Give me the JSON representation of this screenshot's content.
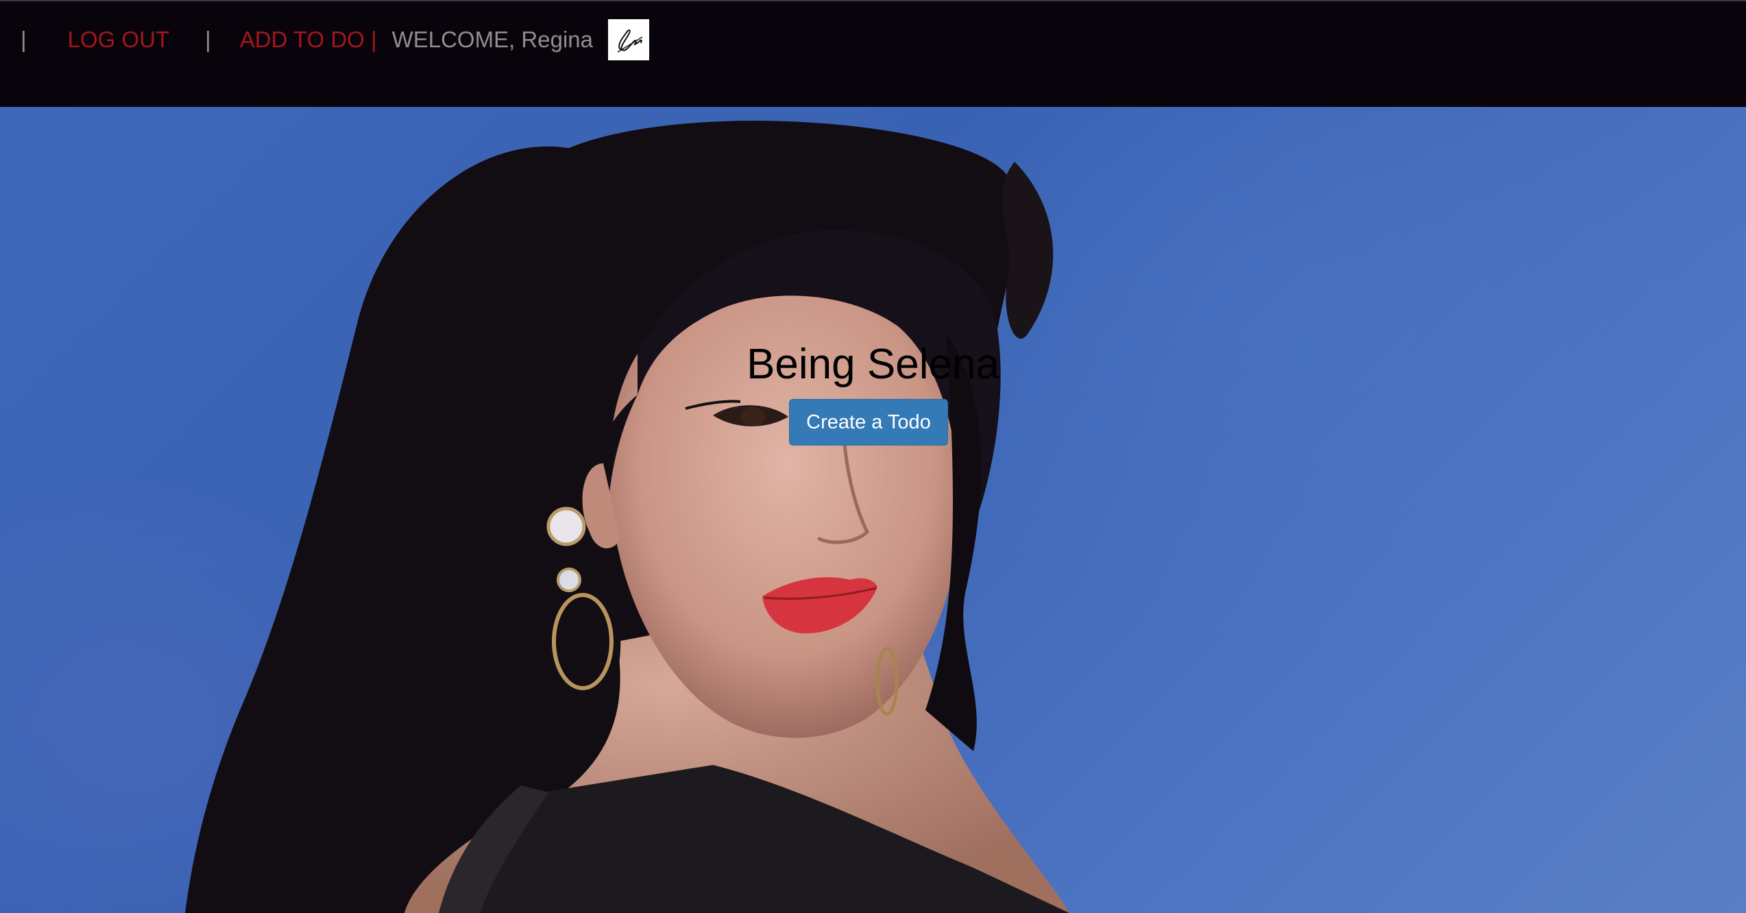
{
  "navbar": {
    "separator_left": "|",
    "logout_label": "LOG OUT",
    "separator_mid": "|",
    "add_todo_label": "ADD TO DO |",
    "welcome_text": "WELCOME, Regina",
    "logo_icon": "selena-signature-logo",
    "background": "#09040c",
    "link_color": "#a3161c"
  },
  "hero": {
    "title": "Being Selena",
    "cta_label": "Create a Todo",
    "cta_color": "#337ab7",
    "background_color": "#3f67b8"
  }
}
